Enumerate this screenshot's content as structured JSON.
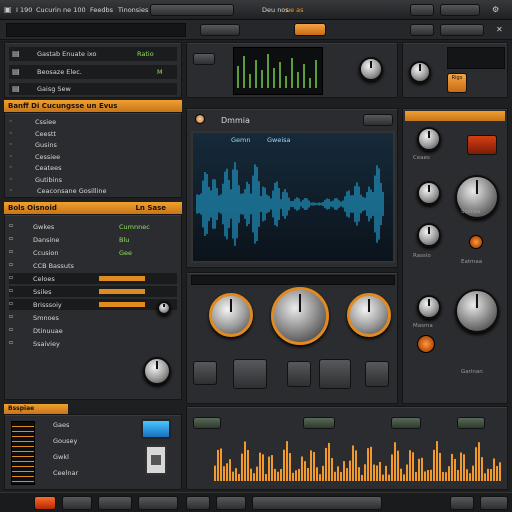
{
  "top_bar": {
    "menu_1": "I 190",
    "menu_2": "Cucurin ne 100",
    "menu_3": "Feedbs",
    "menu_4": "Tinonsies",
    "center_label": "Deu nos",
    "center_value": "ue as"
  },
  "browser": {
    "items": [
      {
        "label": "Gastab Enuate ixo",
        "tag": "Ratio"
      },
      {
        "label": "Beosaze Elec.",
        "tag": "M"
      },
      {
        "label": "Gaisg Sew",
        "tag": ""
      }
    ]
  },
  "tracks_header": "Banff Di Cucungsse un Evus",
  "tracks": [
    {
      "label": "Cssiee"
    },
    {
      "label": "Ceestt"
    },
    {
      "label": "Gusins"
    },
    {
      "label": "Cessiee"
    },
    {
      "label": "Ceatees"
    },
    {
      "label": "Gutibins"
    },
    {
      "label": "Ceaconsane Gosilline"
    }
  ],
  "effects_header": "Bols Oisnoid",
  "effects_header_right": "Ln Sase",
  "effects": [
    {
      "label": "Gwkes",
      "value": "Cumnnec"
    },
    {
      "label": "Dansine",
      "value": "Blu"
    },
    {
      "label": "Ccusion",
      "value": "Gee"
    },
    {
      "label": "CCB Bassuts",
      "value": ""
    },
    {
      "label": "Celoes",
      "value": ""
    },
    {
      "label": "Ssiles",
      "value": ""
    },
    {
      "label": "Brisssoiy",
      "value": ""
    },
    {
      "label": "Smnoes",
      "value": ""
    },
    {
      "label": "Dtinuuae",
      "value": ""
    },
    {
      "label": "Ssaiviey",
      "value": ""
    }
  ],
  "bottom_left_header": "Bsspiae",
  "mixer_labels": [
    "Gaes",
    "Gousey",
    "Gwkl",
    "Ceelnar"
  ],
  "wave_panel": {
    "title": "Dmmia",
    "toolbar_1": "Gemn",
    "toolbar_2": "Gweisa"
  },
  "right_panel": {
    "tag": "Rigs",
    "labels": [
      "Ceaes",
      "Sosiiaa",
      "Rassio",
      "Eatmaa",
      "Masma",
      "Garinan"
    ]
  },
  "colors": {
    "accent": "#f09a2e",
    "waveform": "#25b7f0",
    "green": "#8fe35a",
    "background": "#1e1f21"
  }
}
